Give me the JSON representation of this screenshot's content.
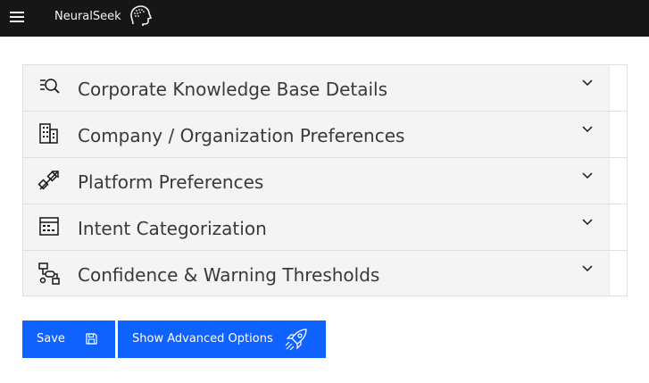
{
  "header": {
    "brand": "NeuralSeek",
    "menu_icon": "hamburger-menu-icon",
    "logo_icon": "neuralseek-head-logo"
  },
  "accordion": {
    "items": [
      {
        "label": "Corporate Knowledge Base Details",
        "icon": "document-search-icon"
      },
      {
        "label": "Company / Organization Preferences",
        "icon": "building-icon"
      },
      {
        "label": "Platform Preferences",
        "icon": "connect-arrows-icon"
      },
      {
        "label": "Intent Categorization",
        "icon": "category-list-icon"
      },
      {
        "label": "Confidence & Warning Thresholds",
        "icon": "threshold-flow-icon"
      }
    ]
  },
  "actions": {
    "save_label": "Save",
    "save_icon": "save-icon",
    "advanced_label": "Show Advanced Options",
    "advanced_icon": "rocket-icon"
  },
  "colors": {
    "topbar": "#161616",
    "primary": "#0f62fe",
    "panel": "#f4f4f4",
    "text": "#393939"
  }
}
